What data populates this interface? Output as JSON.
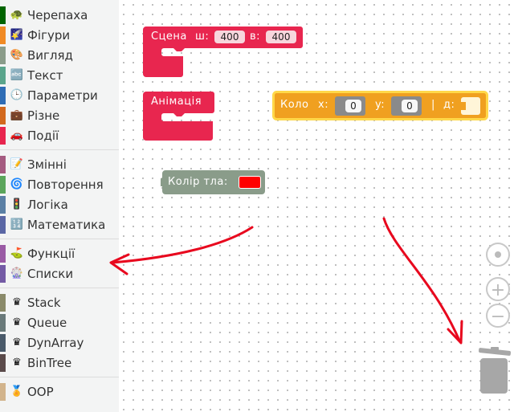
{
  "toolbox": {
    "items": [
      {
        "label": "Черепаха",
        "icon": "🐢",
        "color": "#006400"
      },
      {
        "label": "Фігури",
        "icon": "🌠",
        "color": "#f08a24"
      },
      {
        "label": "Вигляд",
        "icon": "🎨",
        "color": "#8a9c8a"
      },
      {
        "label": "Текст",
        "icon": "🔤",
        "color": "#5ba58c"
      },
      {
        "label": "Параметри",
        "icon": "🕒",
        "color": "#2f6db5"
      },
      {
        "label": "Різне",
        "icon": "💼",
        "color": "#d2691e"
      },
      {
        "label": "Події",
        "icon": "🚗",
        "color": "#e8264f"
      },
      {
        "label": "Змінні",
        "icon": "📝",
        "color": "#a55b80"
      },
      {
        "label": "Повторення",
        "icon": "🌀",
        "color": "#5ba55b"
      },
      {
        "label": "Логіка",
        "icon": "🚦",
        "color": "#5b80a5"
      },
      {
        "label": "Математика",
        "icon": "🔢",
        "color": "#5b67a5"
      },
      {
        "label": "Функції",
        "icon": "⛳",
        "color": "#9a5ba5"
      },
      {
        "label": "Списки",
        "icon": "🎡",
        "color": "#745ba5"
      },
      {
        "label": "Stack",
        "icon": "♛",
        "color": "#8a8a6a"
      },
      {
        "label": "Queue",
        "icon": "♛",
        "color": "#6a7a7a"
      },
      {
        "label": "DynArray",
        "icon": "♛",
        "color": "#4a5a6a"
      },
      {
        "label": "BinTree",
        "icon": "♛",
        "color": "#5a4a4a"
      },
      {
        "label": "OOP",
        "icon": "🏅",
        "color": "#d2b48c"
      }
    ]
  },
  "blocks": {
    "scene": {
      "label": "Сцена",
      "w_label": "ш:",
      "w_value": "400",
      "h_label": "в:",
      "h_value": "400",
      "color": "#e8264f"
    },
    "animation": {
      "label": "Анімація",
      "color": "#e8264f"
    },
    "circle": {
      "label": "Коло",
      "x_label": "x:",
      "x_value": "0",
      "y_label": "y:",
      "y_value": "0",
      "sep": "|",
      "d_label": "д:",
      "color": "#f0a020"
    },
    "bgcolor": {
      "label": "Колір  тла:",
      "color": "#8a9c8a",
      "swatch": "#ff0000"
    }
  },
  "annotation_color": "#e8081e"
}
